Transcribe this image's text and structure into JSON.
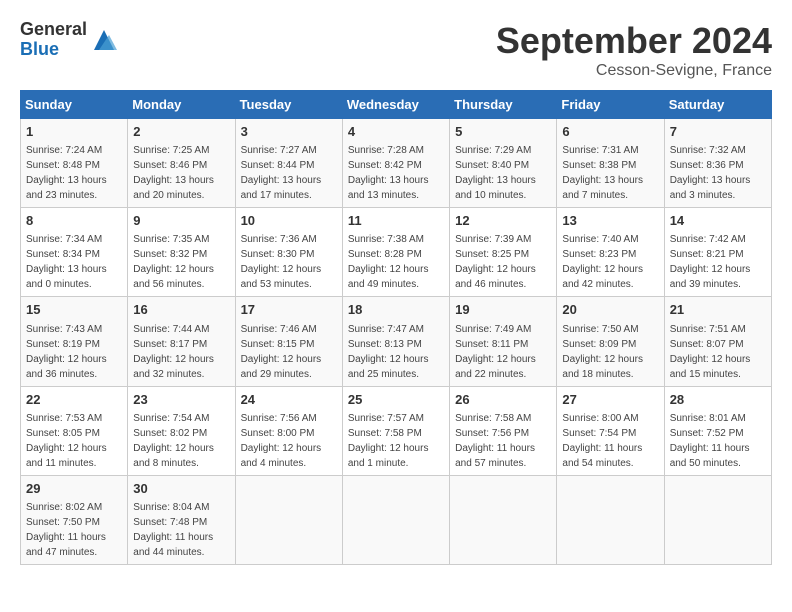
{
  "logo": {
    "general": "General",
    "blue": "Blue"
  },
  "title": "September 2024",
  "location": "Cesson-Sevigne, France",
  "headers": [
    "Sunday",
    "Monday",
    "Tuesday",
    "Wednesday",
    "Thursday",
    "Friday",
    "Saturday"
  ],
  "weeks": [
    [
      {
        "day": "1",
        "info": "Sunrise: 7:24 AM\nSunset: 8:48 PM\nDaylight: 13 hours\nand 23 minutes."
      },
      {
        "day": "2",
        "info": "Sunrise: 7:25 AM\nSunset: 8:46 PM\nDaylight: 13 hours\nand 20 minutes."
      },
      {
        "day": "3",
        "info": "Sunrise: 7:27 AM\nSunset: 8:44 PM\nDaylight: 13 hours\nand 17 minutes."
      },
      {
        "day": "4",
        "info": "Sunrise: 7:28 AM\nSunset: 8:42 PM\nDaylight: 13 hours\nand 13 minutes."
      },
      {
        "day": "5",
        "info": "Sunrise: 7:29 AM\nSunset: 8:40 PM\nDaylight: 13 hours\nand 10 minutes."
      },
      {
        "day": "6",
        "info": "Sunrise: 7:31 AM\nSunset: 8:38 PM\nDaylight: 13 hours\nand 7 minutes."
      },
      {
        "day": "7",
        "info": "Sunrise: 7:32 AM\nSunset: 8:36 PM\nDaylight: 13 hours\nand 3 minutes."
      }
    ],
    [
      {
        "day": "8",
        "info": "Sunrise: 7:34 AM\nSunset: 8:34 PM\nDaylight: 13 hours\nand 0 minutes."
      },
      {
        "day": "9",
        "info": "Sunrise: 7:35 AM\nSunset: 8:32 PM\nDaylight: 12 hours\nand 56 minutes."
      },
      {
        "day": "10",
        "info": "Sunrise: 7:36 AM\nSunset: 8:30 PM\nDaylight: 12 hours\nand 53 minutes."
      },
      {
        "day": "11",
        "info": "Sunrise: 7:38 AM\nSunset: 8:28 PM\nDaylight: 12 hours\nand 49 minutes."
      },
      {
        "day": "12",
        "info": "Sunrise: 7:39 AM\nSunset: 8:25 PM\nDaylight: 12 hours\nand 46 minutes."
      },
      {
        "day": "13",
        "info": "Sunrise: 7:40 AM\nSunset: 8:23 PM\nDaylight: 12 hours\nand 42 minutes."
      },
      {
        "day": "14",
        "info": "Sunrise: 7:42 AM\nSunset: 8:21 PM\nDaylight: 12 hours\nand 39 minutes."
      }
    ],
    [
      {
        "day": "15",
        "info": "Sunrise: 7:43 AM\nSunset: 8:19 PM\nDaylight: 12 hours\nand 36 minutes."
      },
      {
        "day": "16",
        "info": "Sunrise: 7:44 AM\nSunset: 8:17 PM\nDaylight: 12 hours\nand 32 minutes."
      },
      {
        "day": "17",
        "info": "Sunrise: 7:46 AM\nSunset: 8:15 PM\nDaylight: 12 hours\nand 29 minutes."
      },
      {
        "day": "18",
        "info": "Sunrise: 7:47 AM\nSunset: 8:13 PM\nDaylight: 12 hours\nand 25 minutes."
      },
      {
        "day": "19",
        "info": "Sunrise: 7:49 AM\nSunset: 8:11 PM\nDaylight: 12 hours\nand 22 minutes."
      },
      {
        "day": "20",
        "info": "Sunrise: 7:50 AM\nSunset: 8:09 PM\nDaylight: 12 hours\nand 18 minutes."
      },
      {
        "day": "21",
        "info": "Sunrise: 7:51 AM\nSunset: 8:07 PM\nDaylight: 12 hours\nand 15 minutes."
      }
    ],
    [
      {
        "day": "22",
        "info": "Sunrise: 7:53 AM\nSunset: 8:05 PM\nDaylight: 12 hours\nand 11 minutes."
      },
      {
        "day": "23",
        "info": "Sunrise: 7:54 AM\nSunset: 8:02 PM\nDaylight: 12 hours\nand 8 minutes."
      },
      {
        "day": "24",
        "info": "Sunrise: 7:56 AM\nSunset: 8:00 PM\nDaylight: 12 hours\nand 4 minutes."
      },
      {
        "day": "25",
        "info": "Sunrise: 7:57 AM\nSunset: 7:58 PM\nDaylight: 12 hours\nand 1 minute."
      },
      {
        "day": "26",
        "info": "Sunrise: 7:58 AM\nSunset: 7:56 PM\nDaylight: 11 hours\nand 57 minutes."
      },
      {
        "day": "27",
        "info": "Sunrise: 8:00 AM\nSunset: 7:54 PM\nDaylight: 11 hours\nand 54 minutes."
      },
      {
        "day": "28",
        "info": "Sunrise: 8:01 AM\nSunset: 7:52 PM\nDaylight: 11 hours\nand 50 minutes."
      }
    ],
    [
      {
        "day": "29",
        "info": "Sunrise: 8:02 AM\nSunset: 7:50 PM\nDaylight: 11 hours\nand 47 minutes."
      },
      {
        "day": "30",
        "info": "Sunrise: 8:04 AM\nSunset: 7:48 PM\nDaylight: 11 hours\nand 44 minutes."
      },
      {
        "day": "",
        "info": ""
      },
      {
        "day": "",
        "info": ""
      },
      {
        "day": "",
        "info": ""
      },
      {
        "day": "",
        "info": ""
      },
      {
        "day": "",
        "info": ""
      }
    ]
  ]
}
